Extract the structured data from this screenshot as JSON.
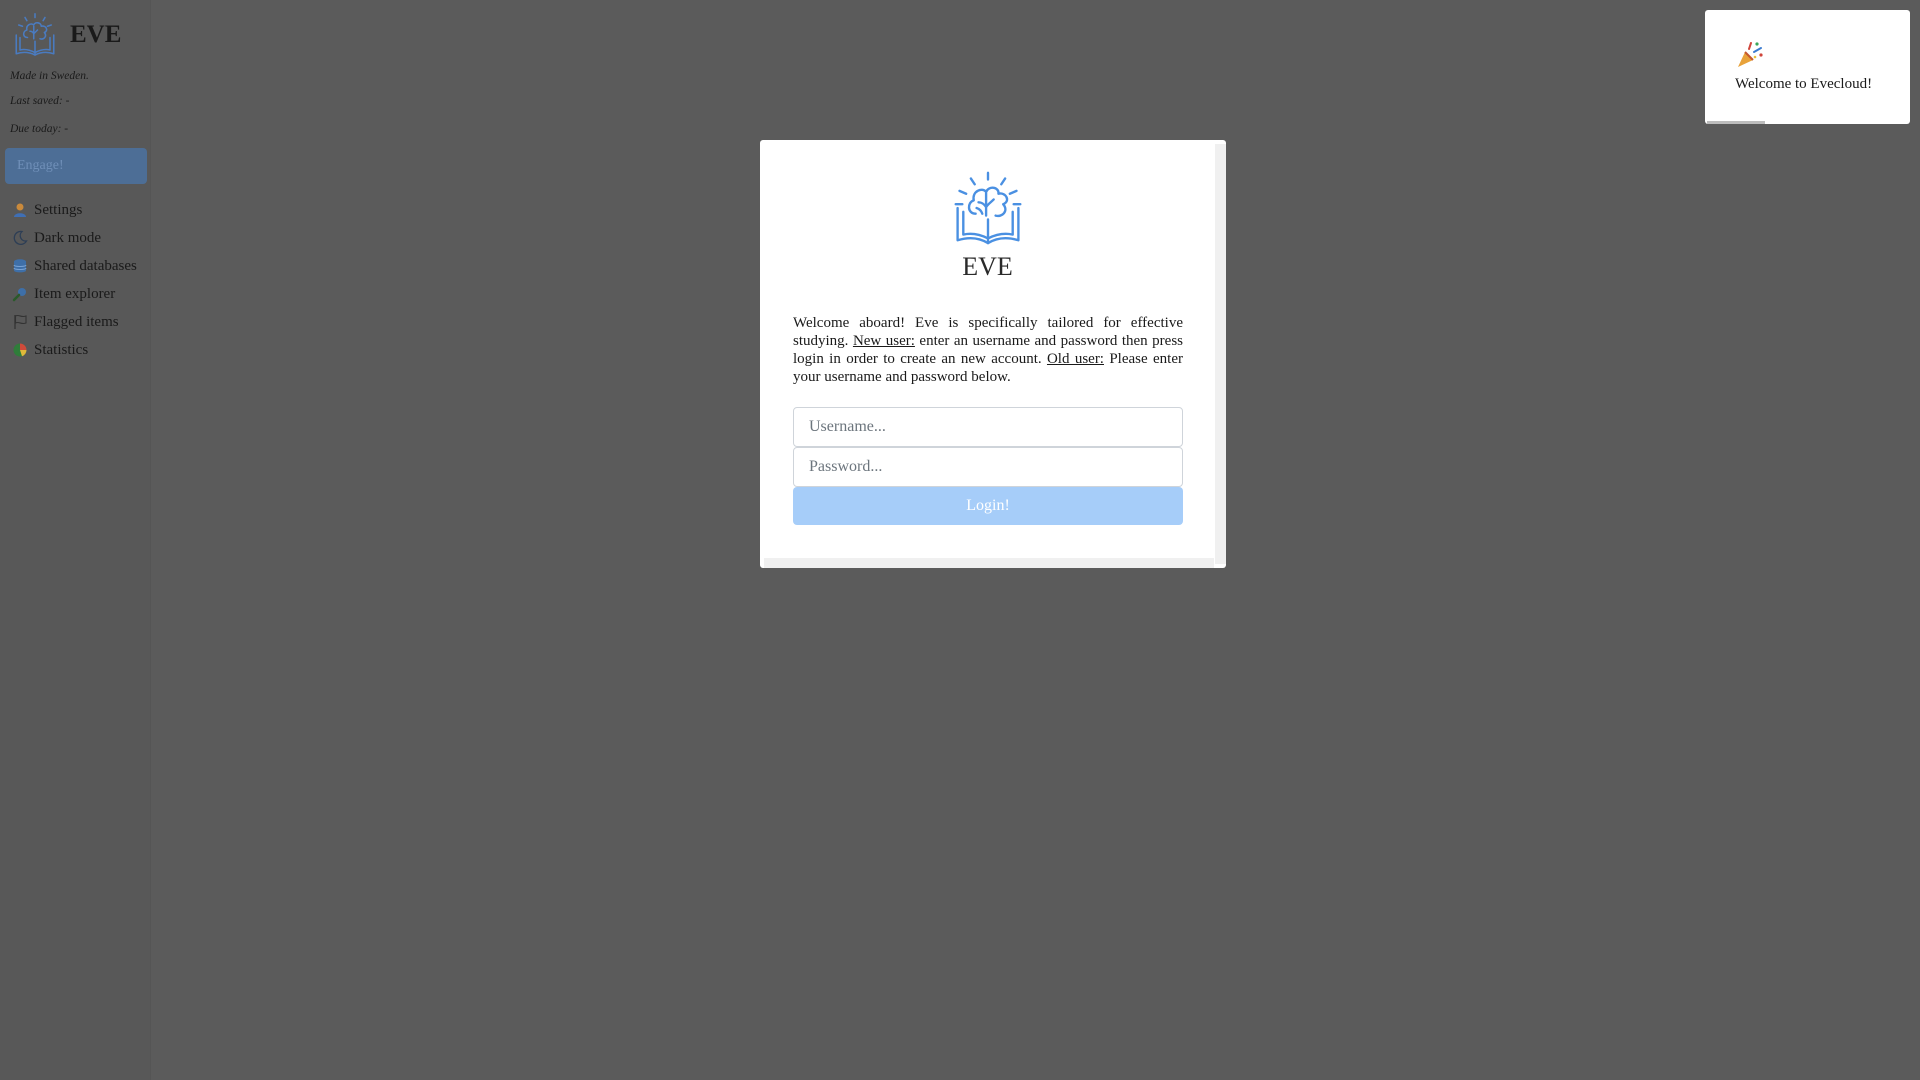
{
  "sidebar": {
    "brand": "EVE",
    "made_in": "Made in Sweden.",
    "last_saved": "Last saved: -",
    "due_today": "Due today: -",
    "engage_label": "Engage!",
    "items": [
      {
        "label": "Settings",
        "icon": "user-icon"
      },
      {
        "label": "Dark mode",
        "icon": "moon-icon"
      },
      {
        "label": "Shared databases",
        "icon": "database-icon"
      },
      {
        "label": "Item explorer",
        "icon": "magnifier-icon"
      },
      {
        "label": "Flagged items",
        "icon": "flag-icon"
      },
      {
        "label": "Statistics",
        "icon": "pie-chart-icon"
      }
    ]
  },
  "modal": {
    "title": "EVE",
    "intro": "Welcome aboard! Eve is specifically tailored for effective studying.",
    "new_user_label": "New user:",
    "new_user_text": "enter an username and password then press login in order to create an new account.",
    "old_user_label": "Old user:",
    "old_user_text": "Please enter your username and password below.",
    "username_placeholder": "Username...",
    "password_placeholder": "Password...",
    "login_label": "Login!"
  },
  "toast": {
    "icon": "party-popper-icon",
    "message": "Welcome to Evecloud!"
  },
  "colors": {
    "overlay": "#5b5b5b",
    "accent": "#4a90e2",
    "login_button": "#a6cdf9"
  }
}
